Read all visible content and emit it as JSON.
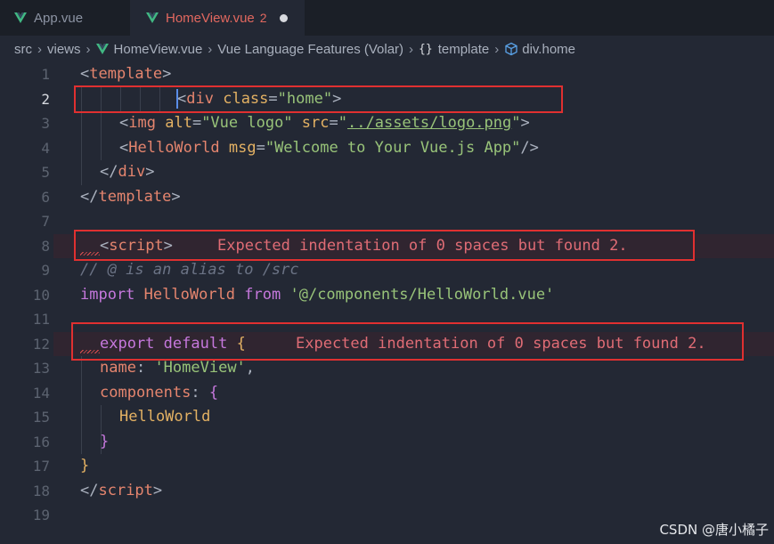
{
  "tabs": [
    {
      "label": "App.vue",
      "active": false
    },
    {
      "label": "HomeView.vue",
      "active": true,
      "badge": "2",
      "modified": true
    }
  ],
  "breadcrumb": [
    "src",
    "views",
    "HomeView.vue",
    "Vue Language Features (Volar)",
    "template",
    "div.home"
  ],
  "editor": {
    "line_numbers": [
      "1",
      "2",
      "3",
      "4",
      "5",
      "6",
      "7",
      "8",
      "9",
      "10",
      "11",
      "12",
      "13",
      "14",
      "15",
      "16",
      "17",
      "18",
      "19"
    ],
    "lines": {
      "l1": {
        "open": "<",
        "tag": "template",
        "close": ">"
      },
      "l2": {
        "open": "<",
        "tag": "div",
        "attr": "class",
        "eq": "=",
        "val": "\"home\"",
        "close": ">"
      },
      "l3": {
        "open": "<",
        "tag": "img",
        "attr1": "alt",
        "eq": "=",
        "val1": "\"Vue logo\"",
        "attr2": "src",
        "q1": "\"",
        "path": "../assets/logo.png",
        "q2": "\"",
        "close": ">"
      },
      "l4": {
        "open": "<",
        "tag": "HelloWorld",
        "attr": "msg",
        "eq": "=",
        "val": "\"Welcome to Your Vue.js App\"",
        "close": "/>"
      },
      "l5": {
        "open": "</",
        "tag": "div",
        "close": ">"
      },
      "l6": {
        "open": "</",
        "tag": "template",
        "close": ">"
      },
      "l8": {
        "open": "<",
        "tag": "script",
        "close": ">"
      },
      "l9": {
        "comment": "// @ is an alias to /src"
      },
      "l10": {
        "kw": "import",
        "name": "HelloWorld",
        "kw2": "from",
        "str": "'@/components/HelloWorld.vue'"
      },
      "l12": {
        "kw1": "export",
        "kw2": "default",
        "brace": "{"
      },
      "l13": {
        "prop": "name",
        "colon": ": ",
        "str": "'HomeView'",
        "comma": ","
      },
      "l14": {
        "prop": "components",
        "colon": ": ",
        "brace": "{"
      },
      "l15": {
        "name": "HelloWorld"
      },
      "l16": {
        "brace": "}"
      },
      "l17": {
        "brace": "}"
      },
      "l18": {
        "open": "</",
        "tag": "script",
        "close": ">"
      }
    },
    "errors": {
      "line8": "Expected indentation of 0 spaces but found 2.",
      "line12": "Expected indentation of 0 spaces but found 2."
    }
  },
  "watermark": "CSDN @唐小橘子",
  "colors": {
    "error": "#e06c75",
    "box": "#e03030",
    "tag": "#e5856e",
    "string": "#98c379",
    "keyword": "#c678dd"
  }
}
